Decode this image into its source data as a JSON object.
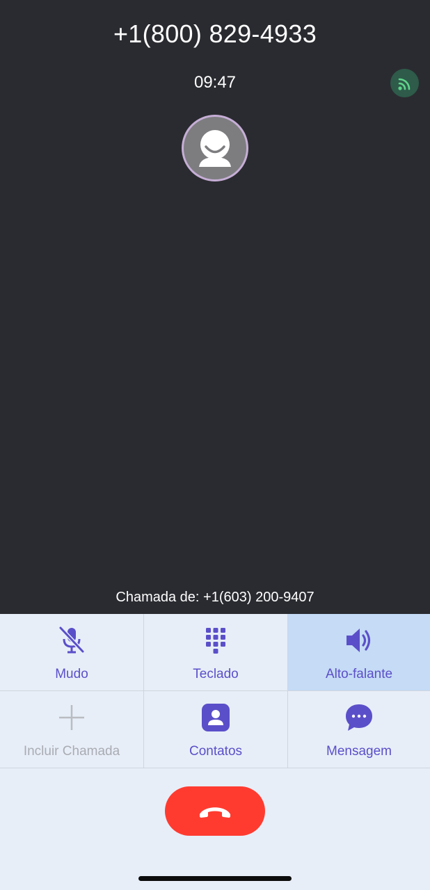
{
  "call": {
    "number": "+1(800) 829-4933",
    "timer": "09:47",
    "caller_from": "Chamada de: +1(603) 200-9407"
  },
  "controls": {
    "mute": {
      "label": "Mudo",
      "icon": "mic-off-icon"
    },
    "keypad": {
      "label": "Teclado",
      "icon": "dialpad-icon"
    },
    "speaker": {
      "label": "Alto-falante",
      "icon": "speaker-icon",
      "active": true
    },
    "add_call": {
      "label": "Incluir Chamada",
      "icon": "plus-icon",
      "disabled": true
    },
    "contacts": {
      "label": "Contatos",
      "icon": "contact-icon"
    },
    "message": {
      "label": "Mensagem",
      "icon": "chat-bubble-icon"
    }
  },
  "end_call": {
    "icon": "phone-hangup-icon"
  },
  "colors": {
    "background": "#2a2b30",
    "panel": "#e8eef8",
    "accent": "#5b4fc9",
    "active_cell": "#c5dbf6",
    "end_call": "#ff3b30",
    "signal": "#5fd48a"
  }
}
